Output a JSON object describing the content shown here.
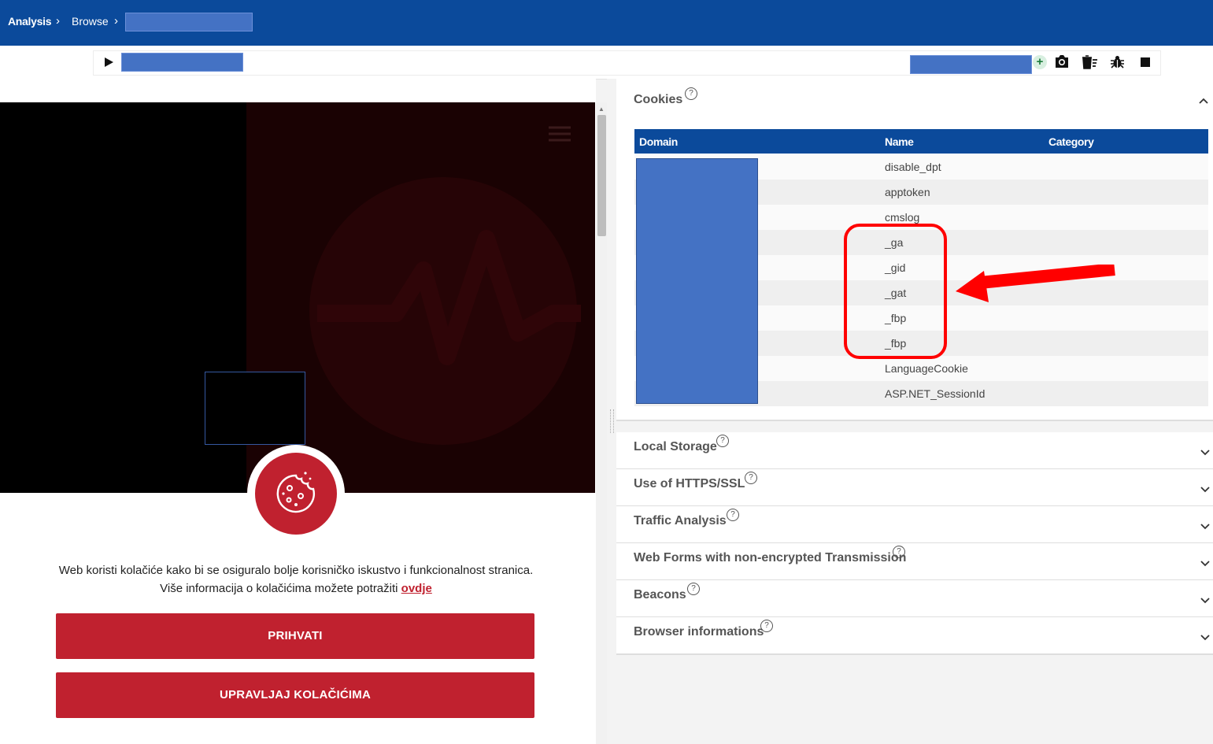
{
  "breadcrumb": {
    "analysis": "Analysis",
    "browse": "Browse"
  },
  "toolbar": {
    "back_icon": "arrow-left-icon",
    "forward_icon": "arrow-right-icon",
    "reload_icon": "reload-icon",
    "play_icon": "play-icon",
    "add_icon": "plus-icon",
    "screenshot_icon": "camera-icon",
    "clear_icon": "trash-list-icon",
    "debug_icon": "bug-icon",
    "stop_icon": "stop-icon"
  },
  "site": {
    "consent_line1": "Web koristi kolačiće kako bi se osiguralo bolje korisničko iskustvo i funkcionalnost stranica.",
    "consent_line2": "Više informacija o kolačićima možete potražiti ",
    "consent_link": "ovdje",
    "accept_label": "PRIHVATI",
    "manage_label": "UPRAVLJAJ KOLAČIĆIMA"
  },
  "cookies": {
    "title": "Cookies",
    "columns": [
      "Domain",
      "Name",
      "Category"
    ],
    "names": [
      "disable_dpt",
      "apptoken",
      "cmslog",
      "_ga",
      "_gid",
      "_gat",
      "_fbp",
      "_fbp",
      "LanguageCookie",
      "ASP.NET_SessionId"
    ]
  },
  "sections": [
    "Local Storage",
    "Use of HTTPS/SSL",
    "Traffic Analysis",
    "Web Forms with non-encrypted Transmission",
    "Beacons",
    "Browser informations"
  ],
  "help_symbol": "?",
  "colors": {
    "header_blue": "#0b4a9b",
    "redaction_blue": "#4472c4",
    "brand_red": "#c0212f",
    "annotation_red": "#ff0000"
  }
}
